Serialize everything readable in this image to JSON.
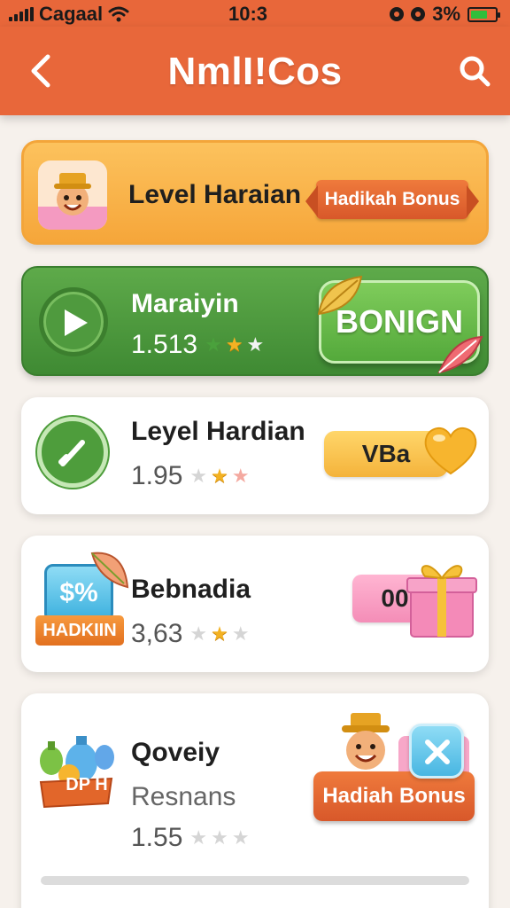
{
  "status_bar": {
    "carrier": "Cagaal",
    "time": "10:3",
    "battery_percent": "3%",
    "battery_color": "#2fbf3b"
  },
  "nav": {
    "title": "NmlI!Cos",
    "back_icon": "chevron-left-icon",
    "search_icon": "search-icon",
    "background": "#e8673a"
  },
  "cards": [
    {
      "title": "Level Haraian",
      "badge": "Hadikah Bonus",
      "icon": "character-avatar-icon"
    },
    {
      "title": "Maraiyin",
      "rating": "1.513",
      "stars": 2.5,
      "button": "BONIGN",
      "icon": "play-icon"
    },
    {
      "title": "Leyel Hardian",
      "rating": "1.95",
      "stars": 1.5,
      "badge": "VBa",
      "icon": "check-icon"
    },
    {
      "title": "Bebnadia",
      "rating": "3,63",
      "stars": 1.5,
      "badge": "00",
      "tag_sign": "$%",
      "tag_label": "HADKIIN",
      "icon": "gift-icon"
    },
    {
      "title": "Qoveiy",
      "subtitle": "Resnans",
      "rating": "1.55",
      "stars": 0,
      "button": "Hadiah Bonus",
      "tag_label": "DP H",
      "icon": "close-icon"
    }
  ],
  "colors": {
    "accent_orange": "#e8673a",
    "card_yellow": "#f6a63a",
    "card_green": "#3f8a33",
    "star": "#f3b223"
  }
}
